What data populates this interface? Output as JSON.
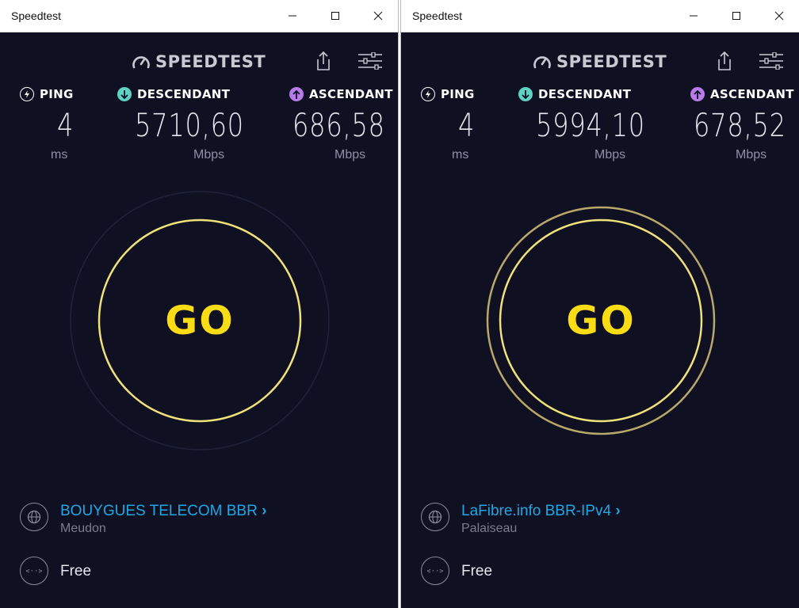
{
  "windows": [
    {
      "title": "Speedtest",
      "logo_text": "SPEEDTEST",
      "ping": {
        "label": "PING",
        "value": "4",
        "unit": "ms"
      },
      "download": {
        "label": "DESCENDANT",
        "value": "5710,60",
        "unit": "Mbps"
      },
      "upload": {
        "label": "ASCENDANT",
        "value": "686,58",
        "unit": "Mbps"
      },
      "go_label": "GO",
      "server": {
        "name": "BOUYGUES TELECOM BBR",
        "location": "Meudon"
      },
      "provider": "Free"
    },
    {
      "title": "Speedtest",
      "logo_text": "SPEEDTEST",
      "ping": {
        "label": "PING",
        "value": "4",
        "unit": "ms"
      },
      "download": {
        "label": "DESCENDANT",
        "value": "5994,10",
        "unit": "Mbps"
      },
      "upload": {
        "label": "ASCENDANT",
        "value": "678,52",
        "unit": "Mbps"
      },
      "go_label": "GO",
      "server": {
        "name": "LaFibre.info BBR-IPv4",
        "location": "Palaiseau"
      },
      "provider": "Free"
    }
  ],
  "colors": {
    "background": "#0f1021",
    "go_yellow": "#fadc14",
    "ping_icon": "#ffffff",
    "download_icon": "#5fd3c3",
    "upload_icon": "#b77ce8",
    "server_link": "#1fa7e3"
  },
  "icons": {
    "logo": "gauge-icon",
    "share": "share-icon",
    "settings": "sliders-icon",
    "ping": "ping-icon",
    "download": "download-arrow-icon",
    "upload": "upload-arrow-icon",
    "server": "globe-icon",
    "provider": "connection-icon"
  }
}
